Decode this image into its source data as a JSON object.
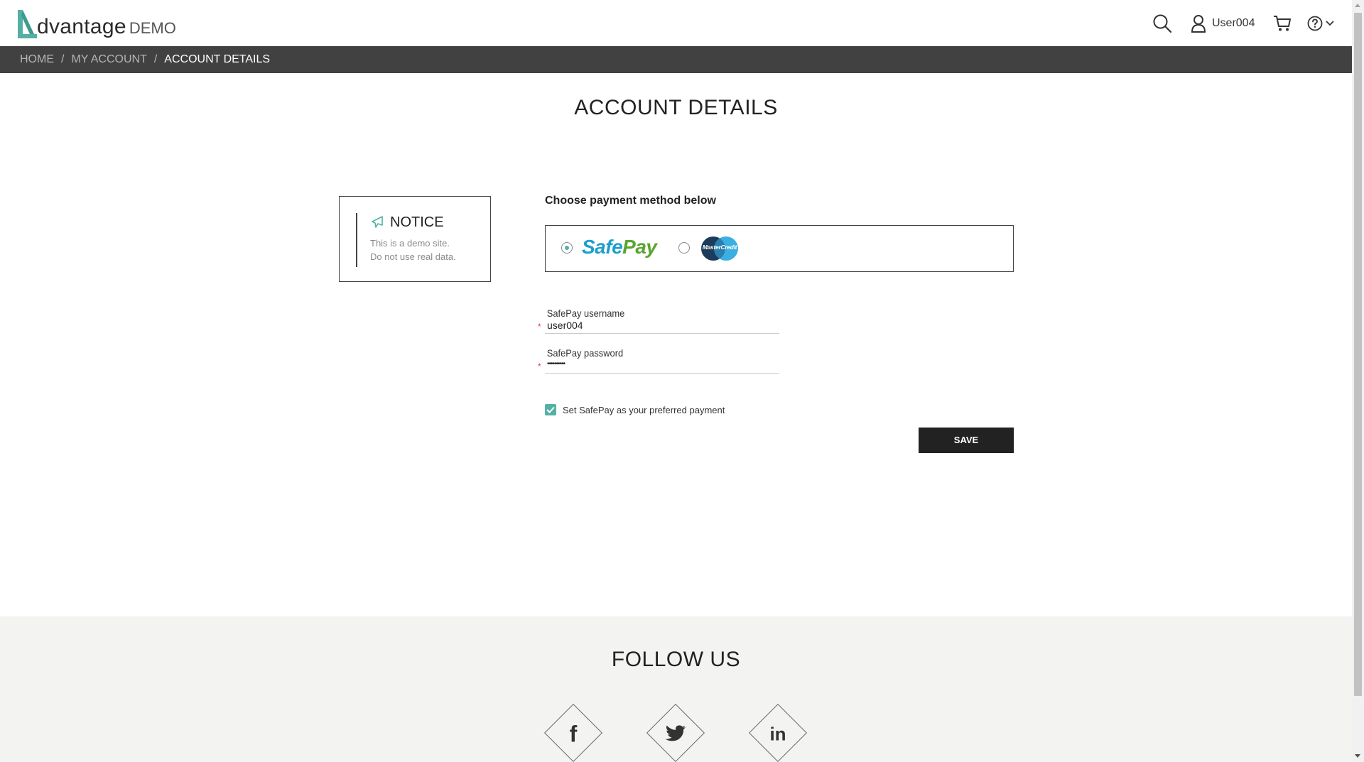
{
  "header": {
    "logo_word": "dvantage",
    "logo_suffix": "DEMO",
    "user_name": "User004"
  },
  "breadcrumb": [
    {
      "label": "HOME"
    },
    {
      "label": "MY ACCOUNT"
    },
    {
      "label": "ACCOUNT DETAILS"
    }
  ],
  "page_title": "ACCOUNT DETAILS",
  "notice": {
    "title": "NOTICE",
    "line1": "This is a demo site.",
    "line2": "Do not use real data."
  },
  "payment": {
    "choose_label": "Choose payment method below",
    "options": [
      {
        "name": "SafePay",
        "logo_part1": "Safe",
        "logo_part2": "Pay",
        "selected": true
      },
      {
        "name": "MasterCredit",
        "logo_text": "MasterCredit",
        "selected": false
      }
    ]
  },
  "fields": {
    "username": {
      "label": "SafePay username",
      "value": "user004"
    },
    "password": {
      "label": "SafePay password",
      "value": "••••••••••"
    }
  },
  "preferred_checkbox": {
    "label": "Set SafePay as your preferred payment",
    "checked": true
  },
  "save_label": "SAVE",
  "footer": {
    "follow_title": "FOLLOW US",
    "social": [
      {
        "icon": "facebook-icon",
        "glyph": "f"
      },
      {
        "icon": "twitter-icon"
      },
      {
        "icon": "linkedin-icon",
        "glyph": "in"
      }
    ]
  },
  "colors": {
    "accent": "#54b0a5",
    "breadcrumb_bg": "#414141",
    "safepay_blue": "#1c9fcf",
    "safepay_green": "#5aa52d",
    "required": "#e0383e",
    "footer_bg": "#f3f3f1"
  }
}
